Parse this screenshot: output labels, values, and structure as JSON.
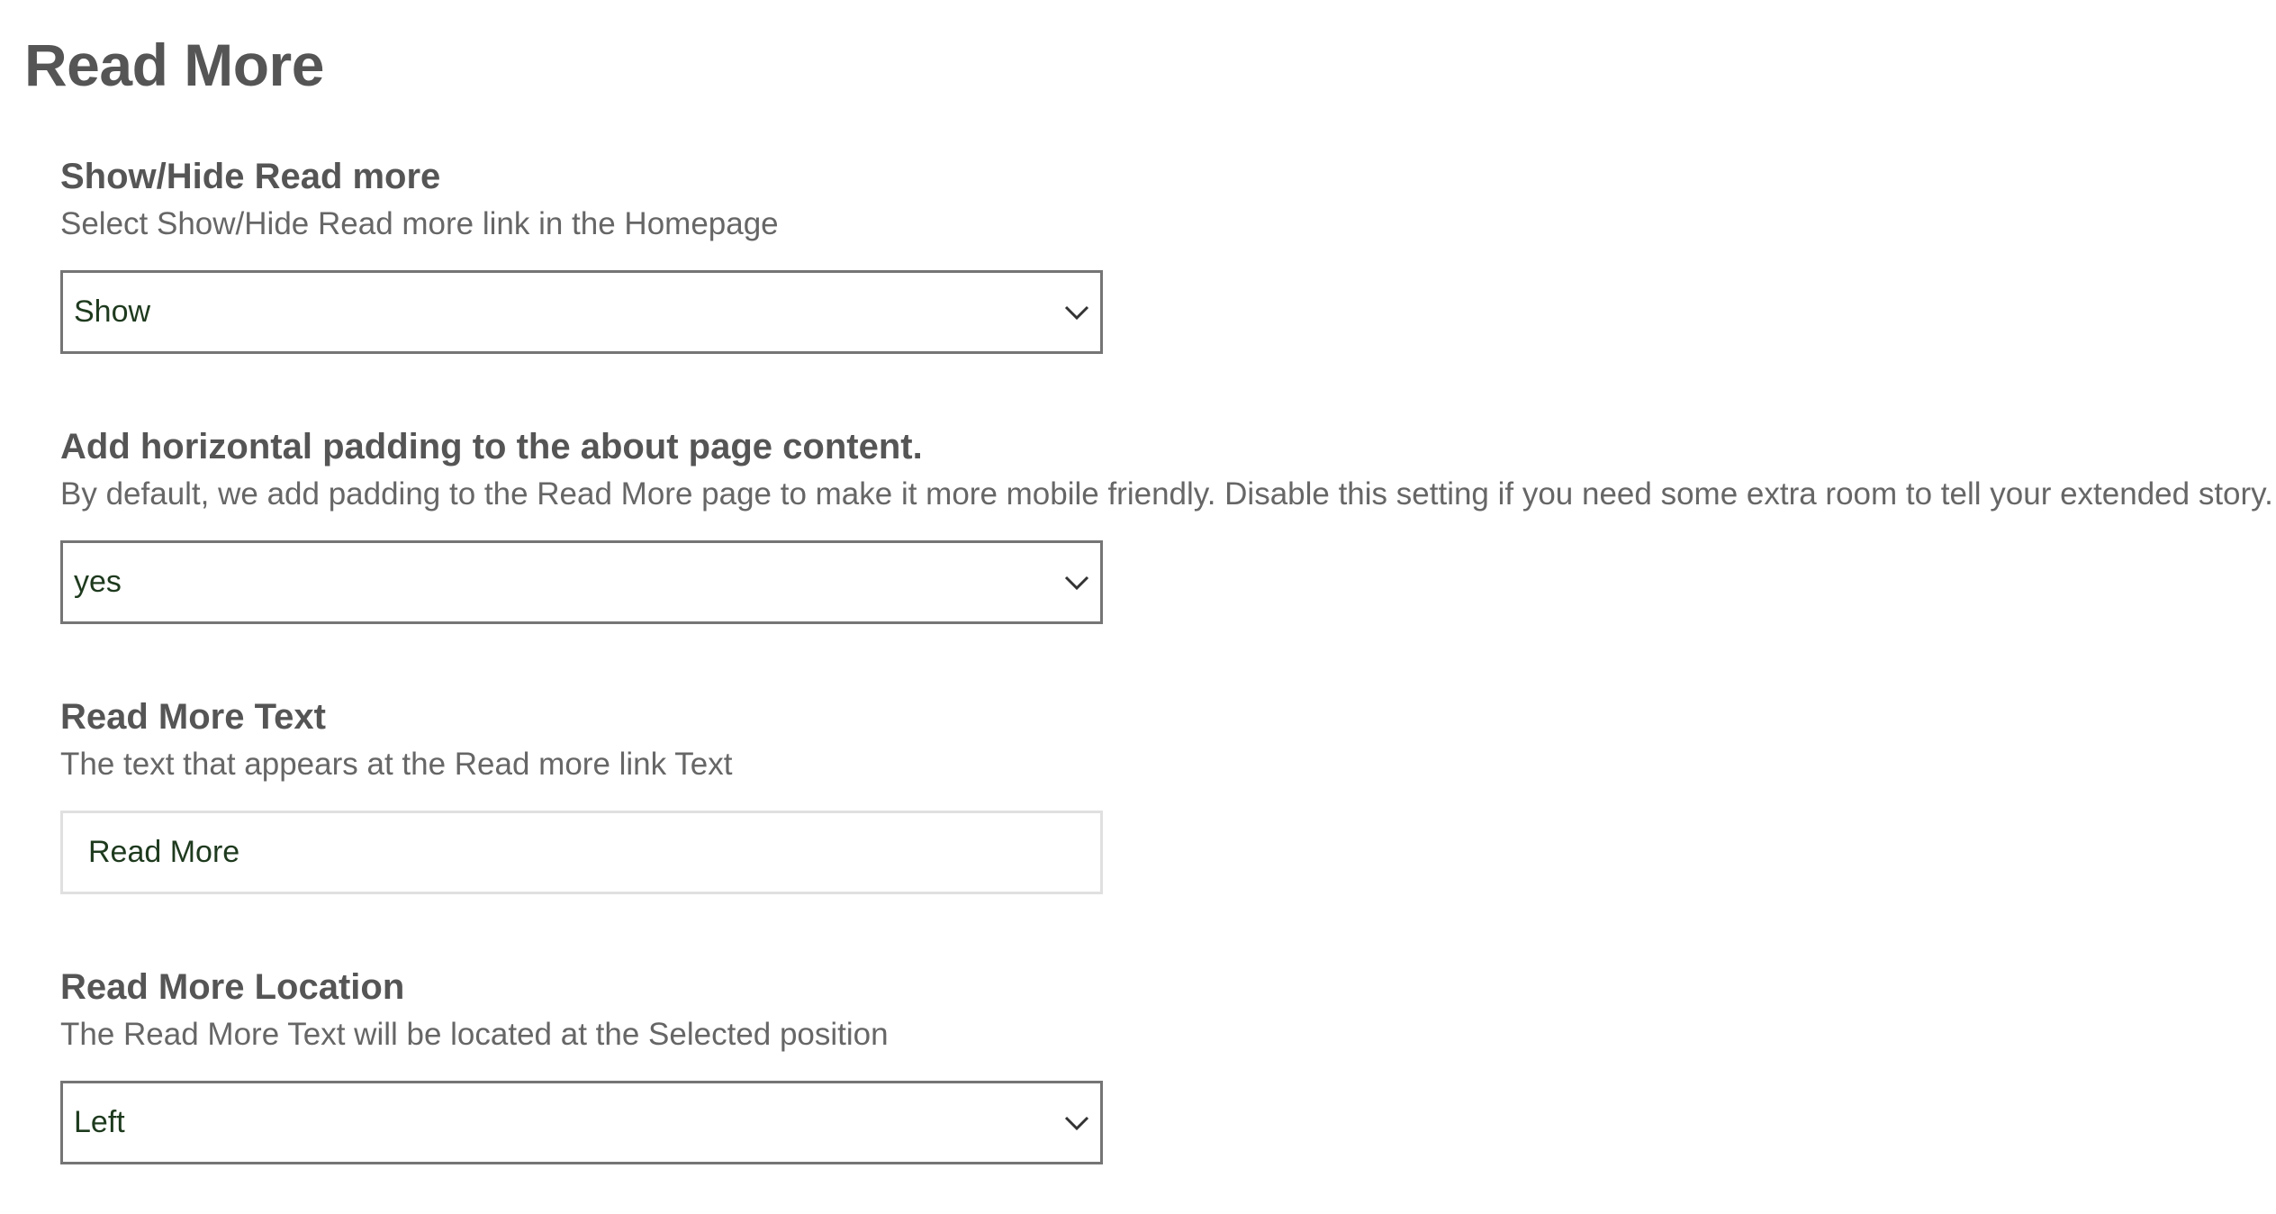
{
  "page": {
    "title": "Read More"
  },
  "settings": {
    "show_hide": {
      "label": "Show/Hide Read more",
      "description": "Select Show/Hide Read more link in the Homepage",
      "value": "Show"
    },
    "padding": {
      "label": "Add horizontal padding to the about page content.",
      "description": "By default, we add padding to the Read More page to make it more mobile friendly. Disable this setting if you need some extra room to tell your extended story.",
      "value": "yes"
    },
    "read_more_text": {
      "label": "Read More Text",
      "description": "The text that appears at the Read more link Text",
      "value": "Read More"
    },
    "location": {
      "label": "Read More Location",
      "description": "The Read More Text will be located at the Selected position",
      "value": "Left"
    }
  },
  "icons": {
    "select_arrow": "chevron-down-icon"
  },
  "colors": {
    "text": "#555555",
    "value_text": "#1e3a1e",
    "select_border": "#757575",
    "input_border": "#e0e0e0"
  }
}
